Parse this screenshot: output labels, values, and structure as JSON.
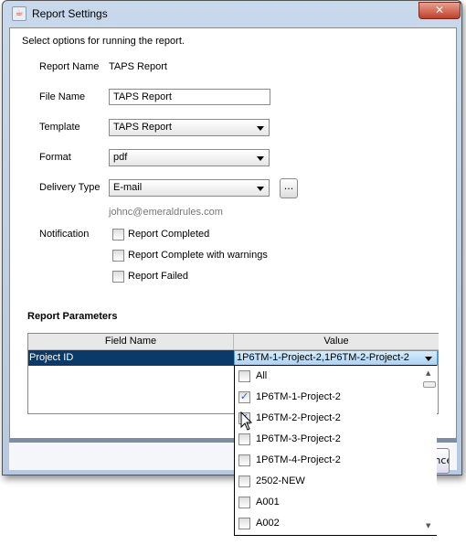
{
  "window": {
    "title": "Report Settings",
    "close_icon": "close-icon"
  },
  "intro": "Select options for running the report.",
  "form": {
    "report_name_label": "Report Name",
    "report_name_value": "TAPS Report",
    "file_name_label": "File Name",
    "file_name_value": "TAPS Report",
    "template_label": "Template",
    "template_value": "TAPS Report",
    "format_label": "Format",
    "format_value": "pdf",
    "delivery_label": "Delivery Type",
    "delivery_value": "E-mail",
    "browse_label": "...",
    "email": "johnc@emeraldrules.com",
    "notification_label": "Notification",
    "notifications": [
      {
        "label": "Report Completed",
        "checked": false
      },
      {
        "label": "Report Complete with warnings",
        "checked": false
      },
      {
        "label": "Report Failed",
        "checked": false
      }
    ]
  },
  "parameters": {
    "heading": "Report Parameters",
    "columns": [
      "Field Name",
      "Value"
    ],
    "rows": [
      {
        "field": "Project ID",
        "value": "1P6TM-1-Project-2,1P6TM-2-Project-2"
      }
    ]
  },
  "dropdown": {
    "items": [
      {
        "label": "All",
        "checked": false
      },
      {
        "label": "1P6TM-1-Project-2",
        "checked": true
      },
      {
        "label": "1P6TM-2-Project-2",
        "checked": true
      },
      {
        "label": "1P6TM-3-Project-2",
        "checked": false
      },
      {
        "label": "1P6TM-4-Project-2",
        "checked": false
      },
      {
        "label": "2502-NEW",
        "checked": false
      },
      {
        "label": "A001",
        "checked": false
      },
      {
        "label": "A002",
        "checked": false
      }
    ]
  },
  "buttons": {
    "cancel_label": "Cancel"
  },
  "colors": {
    "selection": "#0a3a6a",
    "accent_check": "#2a5fb0"
  }
}
